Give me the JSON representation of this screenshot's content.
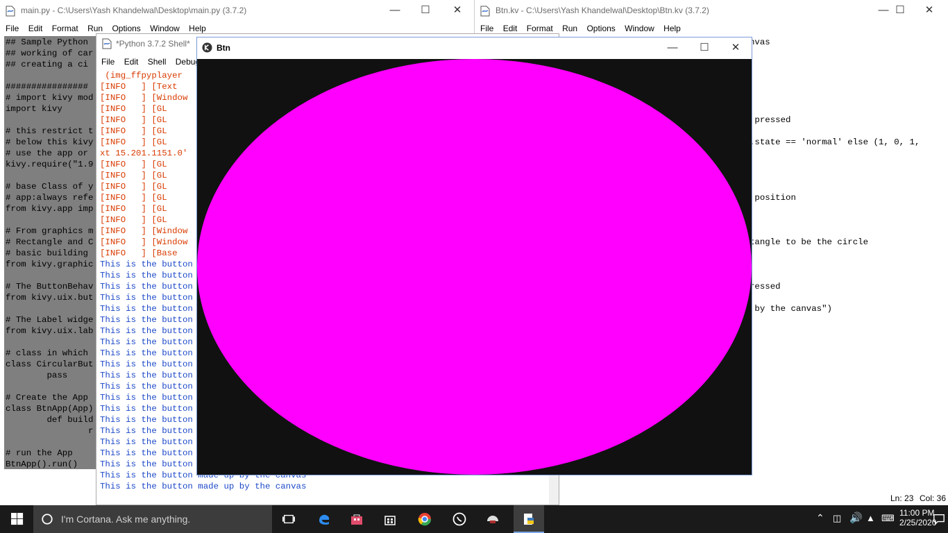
{
  "windows": {
    "main_py": {
      "title": "main.py - C:\\Users\\Yash Khandelwal\\Desktop\\main.py (3.7.2)",
      "menu": [
        "File",
        "Edit",
        "Format",
        "Run",
        "Options",
        "Window",
        "Help"
      ],
      "code_lines": [
        "## Sample Python",
        "## working of car",
        "## creating a ci",
        "",
        "################",
        "# import kivy mod",
        "import kivy",
        "",
        "# this restrict t",
        "# below this kivy",
        "# use the app or",
        "kivy.require(\"1.9",
        "",
        "# base Class of y",
        "# app:always refe",
        "from kivy.app imp",
        "",
        "# From graphics m",
        "# Rectangle and C",
        "# basic building",
        "from kivy.graphic",
        "",
        "# The ButtonBehav",
        "from kivy.uix.but",
        "",
        "# The Label widge",
        "from kivy.uix.lab",
        "",
        "# class in which",
        "class CircularBut",
        "        pass",
        "",
        "# Create the App",
        "class BtnApp(App)",
        "        def build",
        "                r",
        "",
        "# run the App",
        "BtnApp().run()"
      ]
    },
    "shell": {
      "title": "*Python 3.7.2 Shell*",
      "menu": [
        "File",
        "Edit",
        "Shell",
        "Debug"
      ],
      "lines": [
        {
          "t": " (img_ffpyplayer ",
          "c": "red"
        },
        {
          "t": "[INFO   ] [Text  ",
          "c": "red"
        },
        {
          "t": "[INFO   ] [Window",
          "c": "red"
        },
        {
          "t": "[INFO   ] [GL    ",
          "c": "red"
        },
        {
          "t": "[INFO   ] [GL    ",
          "c": "red"
        },
        {
          "t": "[INFO   ] [GL    ",
          "c": "red"
        },
        {
          "t": "[INFO   ] [GL    ",
          "c": "red"
        },
        {
          "t": "xt 15.201.1151.0'",
          "c": "red"
        },
        {
          "t": "[INFO   ] [GL    ",
          "c": "red"
        },
        {
          "t": "[INFO   ] [GL    ",
          "c": "red"
        },
        {
          "t": "[INFO   ] [GL    ",
          "c": "red"
        },
        {
          "t": "[INFO   ] [GL    ",
          "c": "red"
        },
        {
          "t": "[INFO   ] [GL    ",
          "c": "red"
        },
        {
          "t": "[INFO   ] [GL    ",
          "c": "red"
        },
        {
          "t": "[INFO   ] [Window",
          "c": "red"
        },
        {
          "t": "[INFO   ] [Window",
          "c": "red"
        },
        {
          "t": "[INFO   ] [Base  ",
          "c": "red"
        },
        {
          "t": "This is the button",
          "c": "blue"
        },
        {
          "t": "This is the button",
          "c": "blue"
        },
        {
          "t": "This is the button",
          "c": "blue"
        },
        {
          "t": "This is the button",
          "c": "blue"
        },
        {
          "t": "This is the button",
          "c": "blue"
        },
        {
          "t": "This is the button",
          "c": "blue"
        },
        {
          "t": "This is the button",
          "c": "blue"
        },
        {
          "t": "This is the button",
          "c": "blue"
        },
        {
          "t": "This is the button",
          "c": "blue"
        },
        {
          "t": "This is the button",
          "c": "blue"
        },
        {
          "t": "This is the button",
          "c": "blue"
        },
        {
          "t": "This is the button",
          "c": "blue"
        },
        {
          "t": "This is the button",
          "c": "blue"
        },
        {
          "t": "This is the button",
          "c": "blue"
        },
        {
          "t": "This is the button",
          "c": "blue"
        },
        {
          "t": "This is the button",
          "c": "blue"
        },
        {
          "t": "This is the button",
          "c": "blue"
        },
        {
          "t": "This is the button",
          "c": "blue"
        },
        {
          "t": "This is the button made up by the canvas",
          "c": "blue"
        },
        {
          "t": "This is the button made up by the canvas",
          "c": "blue"
        },
        {
          "t": "This is the button made up by the canvas",
          "c": "blue"
        }
      ]
    },
    "btn_kv": {
      "title": "Btn.kv - C:\\Users\\Yash Khandelwal\\Desktop\\Btn.kv (3.7.2)",
      "menu": [
        "File",
        "Edit",
        "Format",
        "Run",
        "Options",
        "Window",
        "Help"
      ],
      "fragments": [
        {
          "t": "nvas",
          "row": 0,
          "col": 0
        },
        {
          "t": " pressed",
          "row": 7,
          "col": 0
        },
        {
          "t": ".state == 'normal' else (1, 0, 1,",
          "row": 9,
          "col": 0
        },
        {
          "t": " position",
          "row": 14,
          "col": 0
        },
        {
          "t": "tangle to be the circle",
          "row": 18,
          "col": 0
        },
        {
          "t": "ressed",
          "row": 22,
          "col": 0
        },
        {
          "t": " by the canvas\")",
          "row": 24,
          "col": 0
        }
      ],
      "status": {
        "line": "Ln: 23",
        "col": "Col: 36"
      }
    },
    "btn_app": {
      "title": "Btn",
      "circle_color": "#ff00ff",
      "bg_color": "#111111"
    }
  },
  "taskbar": {
    "cortana_text": "I'm Cortana. Ask me anything.",
    "time": "11:00 PM",
    "date": "2/25/2020"
  },
  "colors": {
    "accent": "#1c49c8",
    "log_red": "#d83b01",
    "taskbar": "#1a1a1a"
  }
}
